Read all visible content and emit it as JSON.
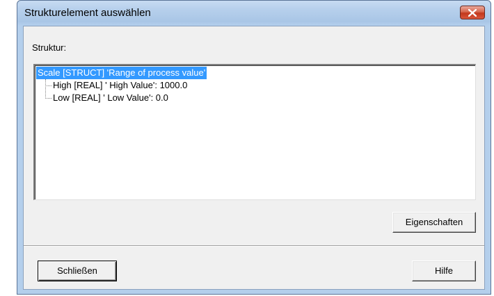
{
  "window": {
    "title": "Strukturelement auswählen"
  },
  "structure": {
    "label": "Struktur:",
    "tree": {
      "root": "Scale [STRUCT] 'Range of process value'",
      "children": [
        "High [REAL] ' High Value':  1000.0",
        "Low [REAL] ' Low Value':  0.0"
      ]
    }
  },
  "buttons": {
    "properties": "Eigenschaften",
    "close": "Schließen",
    "help": "Hilfe"
  },
  "colors": {
    "selection": "#3399ff",
    "close_button": "#c2371c"
  }
}
